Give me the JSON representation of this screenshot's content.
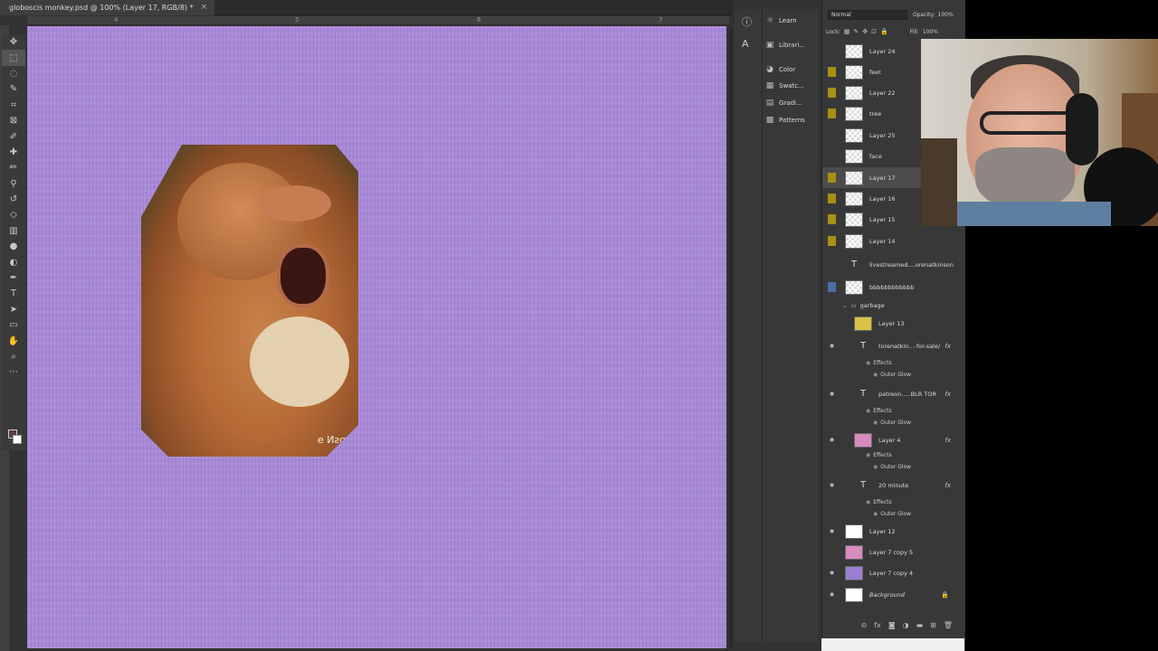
{
  "document": {
    "tab_title": "globoscis monkey.psd @ 100% (Layer 17, RGB/8) *",
    "tab_close": "×",
    "ruler_marks": [
      "4",
      "5",
      "6",
      "7"
    ]
  },
  "toolbar": {
    "tools": [
      "move-tool",
      "marquee-tool",
      "lasso-tool",
      "quick-select-tool",
      "crop-tool",
      "frame-tool",
      "eyedropper-tool",
      "healing-tool",
      "brush-tool",
      "clone-stamp-tool",
      "history-brush-tool",
      "eraser-tool",
      "gradient-tool",
      "blur-tool",
      "dodge-tool",
      "pen-tool",
      "type-tool",
      "path-select-tool",
      "rectangle-tool",
      "hand-tool",
      "zoom-tool",
      "more-tools"
    ],
    "fg_color": "#5a3d41",
    "bg_color": "#ffffff"
  },
  "canvas": {
    "background_color": "#a98ad6",
    "watermark_text": "ɿɒsN ɘ"
  },
  "side_panels": [
    {
      "label": "Learn",
      "icon": "lightbulb-icon"
    },
    {
      "label": "Librari...",
      "icon": "libraries-icon"
    },
    {
      "label": "Color",
      "icon": "color-icon"
    },
    {
      "label": "Swatc...",
      "icon": "swatches-icon"
    },
    {
      "label": "Gradi...",
      "icon": "gradients-icon"
    },
    {
      "label": "Patterns",
      "icon": "patterns-icon"
    }
  ],
  "layers_panel": {
    "blend_mode": "Normal",
    "opacity_label": "Opacity:",
    "opacity_value": "100%",
    "lock_label": "Lock:",
    "fill_label": "Fill:",
    "fill_value": "100%",
    "layers": [
      {
        "name": "Layer 24",
        "vis": "none"
      },
      {
        "name": "feet",
        "vis": "yellow"
      },
      {
        "name": "Layer 22",
        "vis": "yellow"
      },
      {
        "name": "tree",
        "vis": "yellow"
      },
      {
        "name": "Layer 25",
        "vis": "none"
      },
      {
        "name": "face",
        "vis": "none"
      },
      {
        "name": "Layer 17",
        "vis": "yellow"
      },
      {
        "name": "Layer 16",
        "vis": "yellow"
      },
      {
        "name": "Layer 15",
        "vis": "yellow"
      },
      {
        "name": "Layer 14",
        "vis": "yellow"
      }
    ],
    "text_layer_1": "livestreamed....orenatkinson",
    "layer_b": "bbbbbbbbbbbb",
    "group_name": "garbage",
    "layer_13": "Layer 13",
    "text_layer_2": "torenatkin...-for-sale/",
    "text_layer_3": "patreon.....BLR TOR",
    "layer_4": "Layer 4",
    "text_layer_4": "20 minute",
    "effects_label": "Effects",
    "outer_glow_label": "Outer Glow",
    "fx_label": "fx",
    "layer_12": "Layer 12",
    "layer_7c5": "Layer 7 copy 5",
    "layer_7c4": "Layer 7 copy 4",
    "background": "Background"
  }
}
